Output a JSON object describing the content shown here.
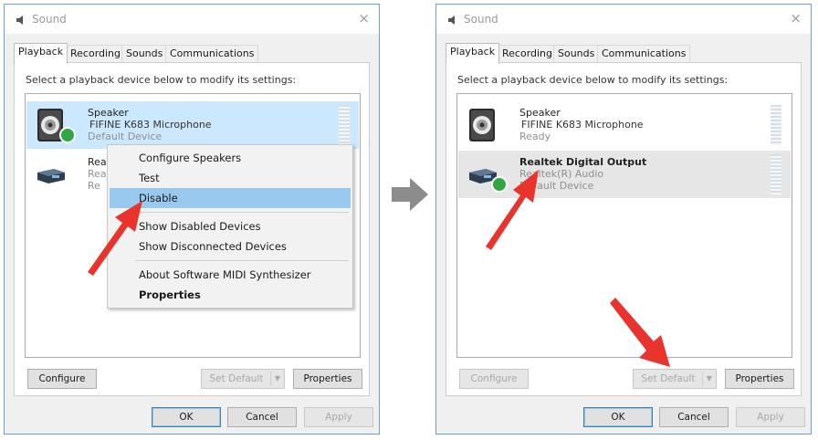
{
  "colors": {
    "selection": "#cce8ff",
    "menu_highlight": "#99c9ef",
    "check_badge": "#2fa841",
    "annotation_arrow": "#e8342c",
    "flow_arrow": "#8c8c8c"
  },
  "left": {
    "title": "Sound",
    "close": "×",
    "tabs": [
      "Playback",
      "Recording",
      "Sounds",
      "Communications"
    ],
    "instruction": "Select a playback device below to modify its settings:",
    "devices": [
      {
        "name": "Speaker",
        "sub": "FIFINE K683 Microphone",
        "status": "Default Device",
        "icon": "speaker-icon"
      },
      {
        "name": "Rea",
        "sub": "Rea",
        "status": "Re",
        "icon": "digital-output-icon"
      }
    ],
    "menu": {
      "items": [
        "Configure Speakers",
        "Test",
        "Disable",
        "Show Disabled Devices",
        "Show Disconnected Devices",
        "About Software MIDI Synthesizer",
        "Properties"
      ],
      "checkmark": "✔"
    },
    "buttons": {
      "configure": "Configure",
      "set_default": "Set Default",
      "properties": "Properties",
      "ok": "OK",
      "cancel": "Cancel",
      "apply": "Apply"
    }
  },
  "right": {
    "title": "Sound",
    "close": "×",
    "tabs": [
      "Playback",
      "Recording",
      "Sounds",
      "Communications"
    ],
    "instruction": "Select a playback device below to modify its settings:",
    "devices": [
      {
        "name": "Speaker",
        "sub": "FIFINE K683 Microphone",
        "status": "Ready",
        "icon": "speaker-icon"
      },
      {
        "name": "Realtek Digital Output",
        "sub": "Realtek(R) Audio",
        "status": "Default Device",
        "icon": "digital-output-icon"
      }
    ],
    "buttons": {
      "configure": "Configure",
      "set_default": "Set Default",
      "properties": "Properties",
      "ok": "OK",
      "cancel": "Cancel",
      "apply": "Apply"
    }
  },
  "split_arrow_glyph": "▼"
}
